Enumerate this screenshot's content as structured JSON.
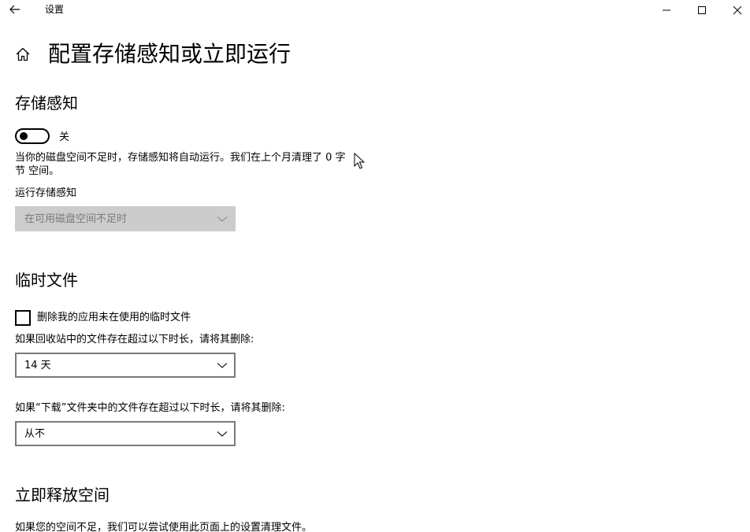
{
  "window": {
    "app_title": "设置"
  },
  "header": {
    "page_title": "配置存储感知或立即运行"
  },
  "storage_sense": {
    "section_title": "存储感知",
    "toggle_state": "关",
    "description": "当你的磁盘空间不足时，存储感知将自动运行。我们在上个月清理了 0 字节 空间。",
    "run_label": "运行存储感知",
    "run_value": "在可用磁盘空间不足时"
  },
  "temp_files": {
    "section_title": "临时文件",
    "checkbox_label": "删除我的应用未在使用的临时文件",
    "recycle_label": "如果回收站中的文件存在超过以下时长，请将其删除:",
    "recycle_value": "14 天",
    "downloads_label": "如果“下载”文件夹中的文件存在超过以下时长，请将其删除:",
    "downloads_value": "从不"
  },
  "free_now": {
    "section_title": "立即释放空间",
    "description": "如果您的空间不足，我们可以尝试使用此页面上的设置清理文件。"
  }
}
